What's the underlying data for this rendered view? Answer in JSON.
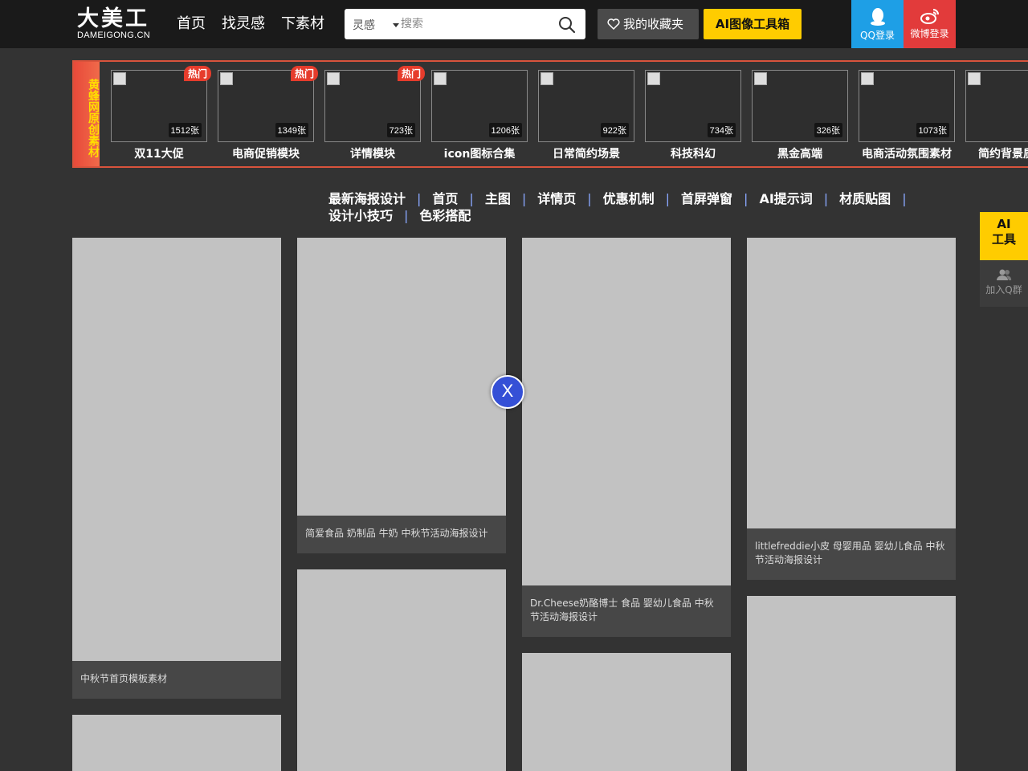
{
  "header": {
    "logo_main": "大美工",
    "logo_sub": "DAMEIGONG.CN",
    "nav": [
      "首页",
      "找灵感",
      "下素材"
    ],
    "search_type": "灵感",
    "search_placeholder": "搜索",
    "favorites": "我的收藏夹",
    "ai_tools": "AI图像工具箱",
    "qq_login": "QQ登录",
    "weibo_login": "微博登录"
  },
  "strip": {
    "label": "黄蜂网原创素材",
    "hot_label": "热门",
    "items": [
      {
        "name": "双11大促",
        "count": "1512张",
        "hot": true
      },
      {
        "name": "电商促销模块",
        "count": "1349张",
        "hot": true
      },
      {
        "name": "详情模块",
        "count": "723张",
        "hot": true
      },
      {
        "name": "icon图标合集",
        "count": "1206张",
        "hot": false
      },
      {
        "name": "日常简约场景",
        "count": "922张",
        "hot": false
      },
      {
        "name": "科技科幻",
        "count": "734张",
        "hot": false
      },
      {
        "name": "黑金高端",
        "count": "326张",
        "hot": false
      },
      {
        "name": "电商活动氛围素材",
        "count": "1073张",
        "hot": false
      },
      {
        "name": "简约背景质",
        "count": "",
        "hot": false
      }
    ]
  },
  "tags": [
    "最新海报设计",
    "首页",
    "主图",
    "详情页",
    "优惠机制",
    "首屏弹窗",
    "AI提示词",
    "材质贴图",
    "设计小技巧",
    "色彩搭配"
  ],
  "side": {
    "ai_line1": "AI",
    "ai_line2": "工具",
    "qq_group": "加入Q群"
  },
  "cards": [
    {
      "caption": "中秋节首页模板素材"
    },
    {
      "caption": "简爱食品 奶制品 牛奶 中秋节活动海报设计"
    },
    {
      "caption": "Dr.Cheese奶酪博士 食品 婴幼儿食品 中秋节活动海报设计"
    },
    {
      "caption": "littlefreddie小皮 母婴用品 婴幼儿食品 中秋节活动海报设计"
    }
  ],
  "close_label": "X",
  "colors": {
    "accent_yellow": "#ffcc00",
    "qq_blue": "#1e9fe6",
    "weibo_red": "#e23b3b",
    "strip_border": "#d9533c",
    "close_blue": "#3550d6"
  }
}
